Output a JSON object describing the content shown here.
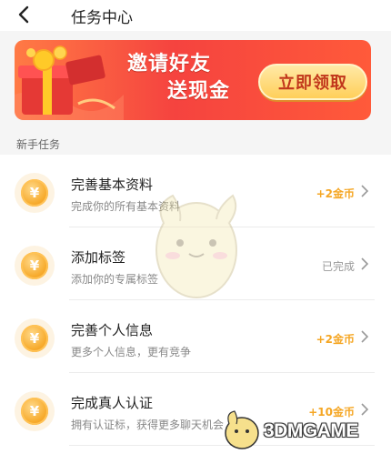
{
  "header": {
    "title": "任务中心"
  },
  "banner": {
    "line1": "邀请好友",
    "line2": "送现金",
    "button_label": "立即领取"
  },
  "section": {
    "label": "新手任务"
  },
  "tasks": [
    {
      "title": "完善基本资料",
      "desc": "完成你的所有基本资料",
      "reward": "+2金币",
      "done": false
    },
    {
      "title": "添加标签",
      "desc": "添加你的专属标签",
      "reward": "已完成",
      "done": true
    },
    {
      "title": "完善个人信息",
      "desc": "更多个人信息，更有竞争",
      "reward": "+2金币",
      "done": false
    },
    {
      "title": "完成真人认证",
      "desc": "拥有认证标，获得更多聊天机会",
      "reward": "+10金币",
      "done": false
    }
  ],
  "coin_symbol": "¥",
  "watermark": {
    "text": "3DMGAME"
  },
  "colors": {
    "accent": "#f5a623",
    "banner_red": "#f5433f",
    "done_gray": "#999999"
  }
}
